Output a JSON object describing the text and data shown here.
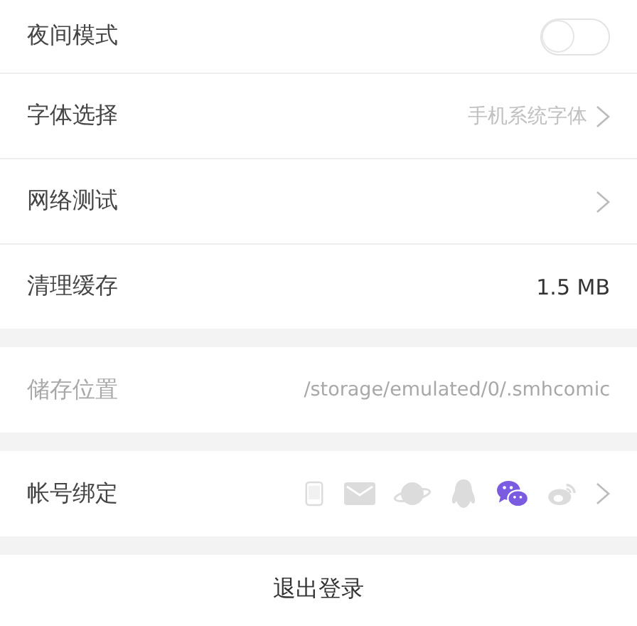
{
  "settings": [
    {
      "kind": "toggle",
      "label": "夜间模式",
      "on": false
    },
    {
      "kind": "link",
      "label": "字体选择",
      "value": "手机系统字体"
    },
    {
      "kind": "link",
      "label": "网络测试"
    },
    {
      "kind": "value",
      "label": "清理缓存",
      "value": "1.5 MB"
    },
    {
      "kind": "gap"
    },
    {
      "kind": "value",
      "label": "储存位置",
      "value": "/storage/emulated/0/.smhcomic",
      "disabled": true
    },
    {
      "kind": "gap"
    },
    {
      "kind": "accounts",
      "label": "帐号绑定",
      "accounts": [
        {
          "kind": "phone",
          "bound": false
        },
        {
          "kind": "mail",
          "bound": false
        },
        {
          "kind": "planet",
          "bound": false
        },
        {
          "kind": "penguin",
          "bound": false
        },
        {
          "kind": "chat",
          "bound": true
        },
        {
          "kind": "eye",
          "bound": false
        }
      ]
    },
    {
      "kind": "gap"
    }
  ],
  "logout": "退出登录"
}
